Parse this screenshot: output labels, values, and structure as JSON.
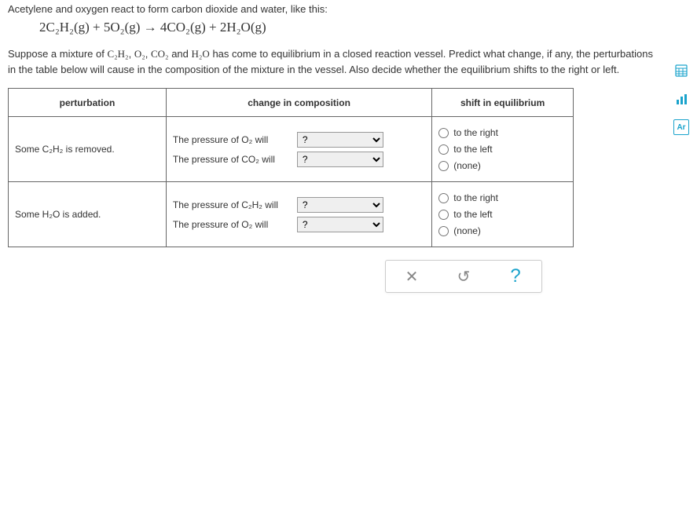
{
  "intro": "Acetylene and oxygen react to form carbon dioxide and water, like this:",
  "equation": "2C₂H₂(g) + 5O₂(g) → 4CO₂(g) + 2H₂O(g)",
  "para_before": "Suppose a mixture of ",
  "para_species_c2h2": "C₂H₂",
  "para_species_o2": "O₂",
  "para_species_co2": "CO₂",
  "para_species_h2o": "H₂O",
  "para_mid": " has come to equilibrium in a closed reaction vessel. Predict what change, if any, the perturbations in the table below will cause in the composition of the mixture in the vessel. Also decide whether the equilibrium shifts to the right or left.",
  "headers": {
    "perturbation": "perturbation",
    "change": "change in composition",
    "shift": "shift in equilibrium"
  },
  "rows": [
    {
      "perturbation": "Some C₂H₂ is removed.",
      "changes": [
        {
          "label": "The pressure of O₂ will",
          "value": "?"
        },
        {
          "label": "The pressure of CO₂ will",
          "value": "?"
        }
      ]
    },
    {
      "perturbation": "Some H₂O is added.",
      "changes": [
        {
          "label": "The pressure of C₂H₂ will",
          "value": "?"
        },
        {
          "label": "The pressure of O₂ will",
          "value": "?"
        }
      ]
    }
  ],
  "shift_options": {
    "right": "to the right",
    "left": "to the left",
    "none": "(none)"
  },
  "select_options": [
    "?"
  ],
  "actions": {
    "close": "✕",
    "reset": "↺",
    "help": "?"
  },
  "sidebar": {
    "calc": "▦",
    "bar": "⬍",
    "ar": "Ar"
  }
}
